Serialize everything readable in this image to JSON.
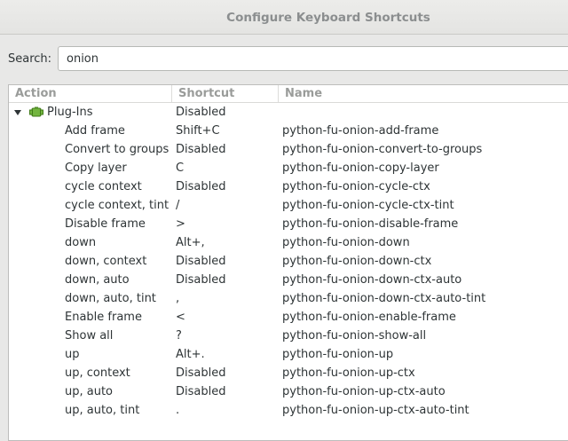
{
  "window": {
    "title": "Configure Keyboard Shortcuts"
  },
  "search": {
    "label": "Search:",
    "value": "onion"
  },
  "columns": {
    "action": "Action",
    "shortcut": "Shortcut",
    "name": "Name"
  },
  "group": {
    "label": "Plug-Ins",
    "shortcut": "Disabled",
    "icon": "plugin-icon",
    "expanded": true
  },
  "rows": [
    {
      "action": "Add frame",
      "shortcut": "Shift+C",
      "name": "python-fu-onion-add-frame"
    },
    {
      "action": "Convert to groups",
      "shortcut": "Disabled",
      "name": "python-fu-onion-convert-to-groups"
    },
    {
      "action": "Copy layer",
      "shortcut": "C",
      "name": "python-fu-onion-copy-layer"
    },
    {
      "action": "cycle context",
      "shortcut": "Disabled",
      "name": "python-fu-onion-cycle-ctx"
    },
    {
      "action": "cycle context, tint",
      "shortcut": "/",
      "name": "python-fu-onion-cycle-ctx-tint"
    },
    {
      "action": "Disable frame",
      "shortcut": ">",
      "name": "python-fu-onion-disable-frame"
    },
    {
      "action": "down",
      "shortcut": "Alt+,",
      "name": "python-fu-onion-down"
    },
    {
      "action": "down, context",
      "shortcut": "Disabled",
      "name": "python-fu-onion-down-ctx"
    },
    {
      "action": "down, auto",
      "shortcut": "Disabled",
      "name": "python-fu-onion-down-ctx-auto"
    },
    {
      "action": "down, auto, tint",
      "shortcut": ",",
      "name": "python-fu-onion-down-ctx-auto-tint"
    },
    {
      "action": "Enable frame",
      "shortcut": "<",
      "name": "python-fu-onion-enable-frame"
    },
    {
      "action": "Show all",
      "shortcut": "?",
      "name": "python-fu-onion-show-all"
    },
    {
      "action": "up",
      "shortcut": "Alt+.",
      "name": "python-fu-onion-up"
    },
    {
      "action": "up, context",
      "shortcut": "Disabled",
      "name": "python-fu-onion-up-ctx"
    },
    {
      "action": "up, auto",
      "shortcut": "Disabled",
      "name": "python-fu-onion-up-ctx-auto"
    },
    {
      "action": "up, auto, tint",
      "shortcut": ".",
      "name": "python-fu-onion-up-ctx-auto-tint"
    }
  ]
}
